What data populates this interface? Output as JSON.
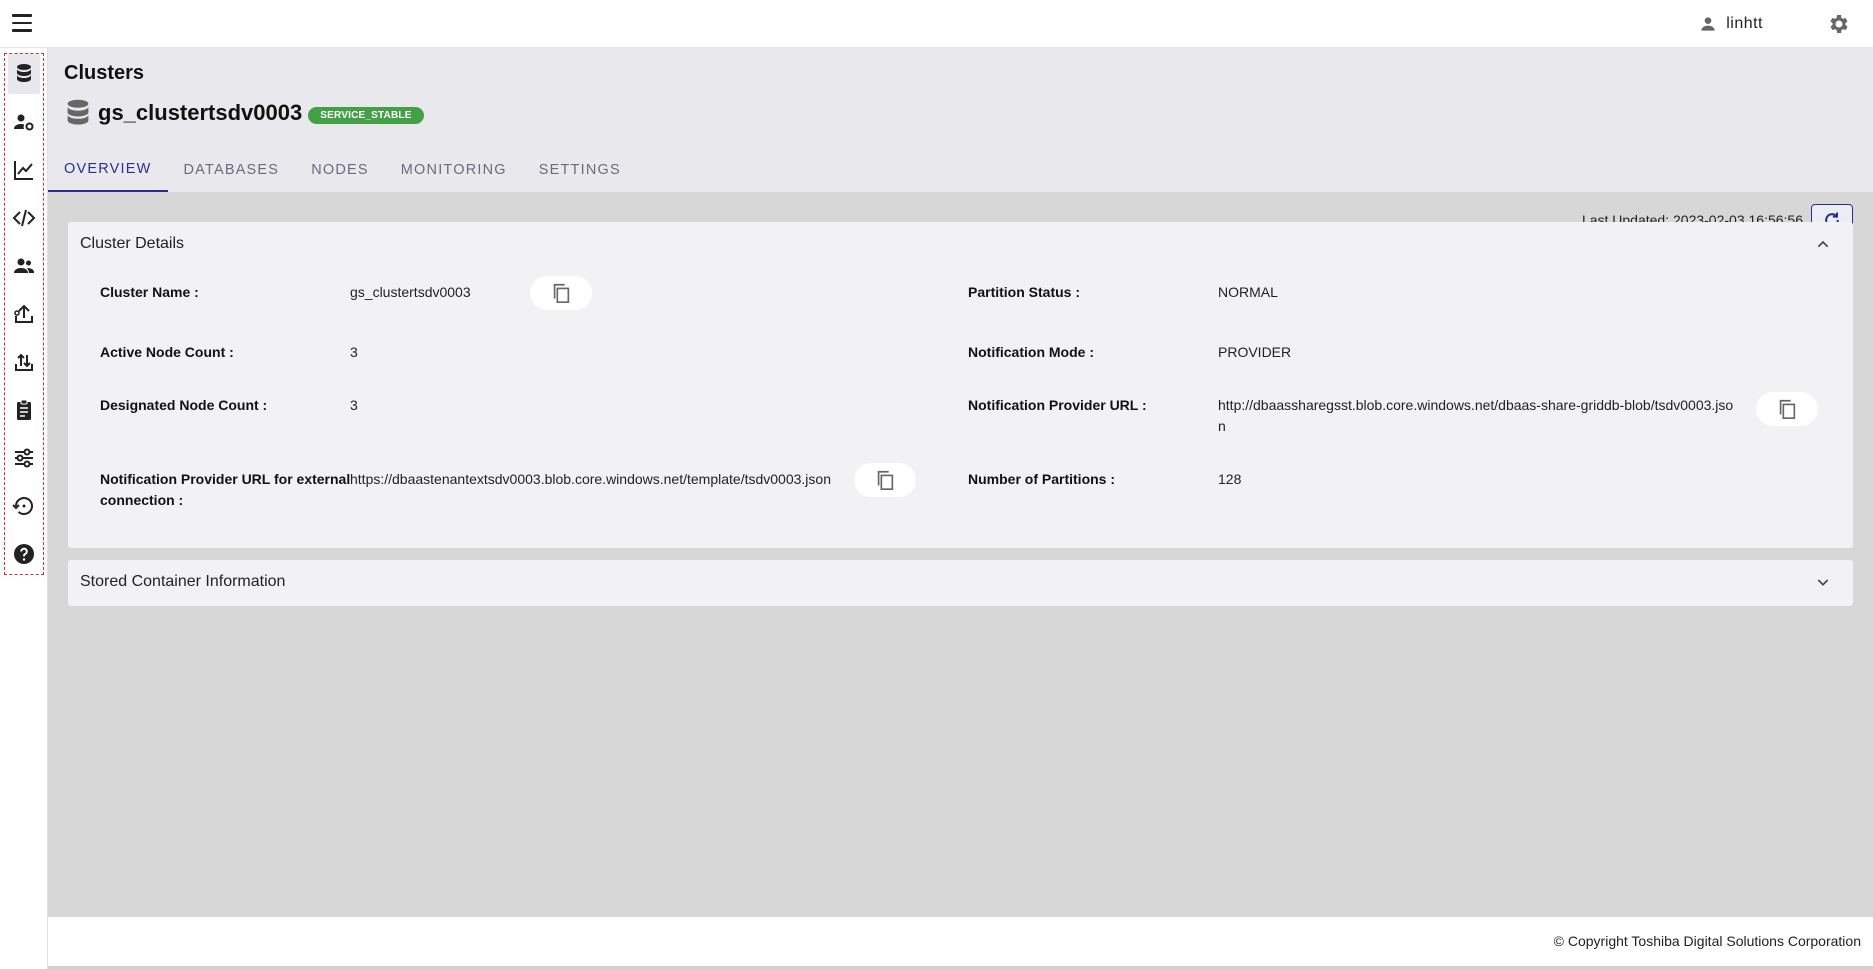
{
  "topbar": {
    "username": "linhtt"
  },
  "sidebar": {
    "items": [
      {
        "name": "sidebar-item-clusters",
        "icon": "database-icon"
      },
      {
        "name": "sidebar-item-user-management",
        "icon": "user-gear-icon"
      },
      {
        "name": "sidebar-item-monitoring",
        "icon": "chart-line-icon"
      },
      {
        "name": "sidebar-item-code",
        "icon": "code-icon"
      },
      {
        "name": "sidebar-item-users",
        "icon": "users-icon"
      },
      {
        "name": "sidebar-item-upload",
        "icon": "upload-icon"
      },
      {
        "name": "sidebar-item-import-export",
        "icon": "swap-icon"
      },
      {
        "name": "sidebar-item-clipboard",
        "icon": "clipboard-icon"
      },
      {
        "name": "sidebar-item-settings",
        "icon": "sliders-icon"
      },
      {
        "name": "sidebar-item-restore",
        "icon": "restore-icon"
      },
      {
        "name": "sidebar-item-help",
        "icon": "help-icon"
      }
    ]
  },
  "header": {
    "breadcrumb": "Clusters",
    "cluster_name": "gs_clustertsdv0003",
    "status_badge": "SERVICE_STABLE",
    "tabs": [
      "OVERVIEW",
      "DATABASES",
      "NODES",
      "MONITORING",
      "SETTINGS"
    ],
    "active_tab": "OVERVIEW"
  },
  "toolbar": {
    "last_updated": "Last Updated: 2023-02-03 16:56:56"
  },
  "cluster_details": {
    "title": "Cluster Details",
    "left": [
      {
        "label": "Cluster Name :",
        "value": "gs_clustertsdv0003"
      },
      {
        "label": "Active Node Count :",
        "value": "3"
      },
      {
        "label": "Designated Node Count :",
        "value": "3"
      },
      {
        "label_line1": "Notification Provider URL for external",
        "label_line2": "connection :",
        "value": "https://dbaastenantextsdv0003.blob.core.windows.net/template/tsdv0003.json"
      }
    ],
    "right": [
      {
        "label": "Partition Status :",
        "value": "NORMAL"
      },
      {
        "label": "Notification Mode :",
        "value": "PROVIDER"
      },
      {
        "label": "Notification Provider URL :",
        "value_line1": "http://dbaassharegsst.blob.core.windows.net/dbaas-share-griddb-blob/tsdv0003.jso",
        "value_line2": "n"
      },
      {
        "label": "Number of Partitions :",
        "value": "128"
      }
    ]
  },
  "stored_container": {
    "title": "Stored Container Information"
  },
  "footer": {
    "copyright": "© Copyright Toshiba Digital Solutions Corporation"
  },
  "colors": {
    "accent": "#2a2f8f",
    "badge": "#43a047",
    "sidebar_highlight": "#d32f2f"
  }
}
